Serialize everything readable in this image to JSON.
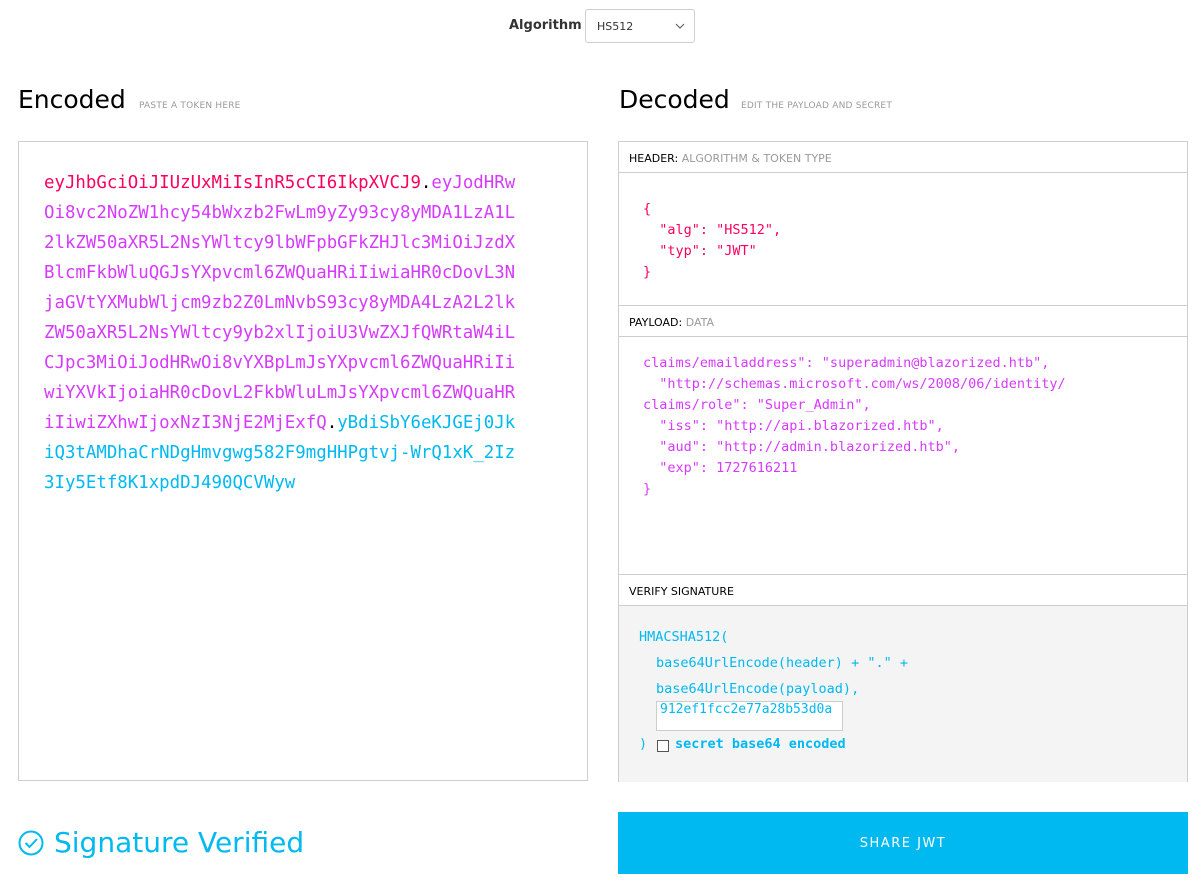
{
  "algorithm": {
    "label": "Algorithm",
    "selected": "HS512"
  },
  "encoded": {
    "title": "Encoded",
    "subtitle": "PASTE A TOKEN HERE",
    "token_header": "eyJhbGciOiJIUzUxMiIsInR5cCI6IkpXVCJ9",
    "token_payload": "eyJodHRwOi8vc2NoZW1hcy54bWxzb2FwLm9yZy93cy8yMDA1LzA1L2lkZW50aXR5L2NsYWltcy9lbWFpbGFkZHJlc3MiOiJzdXBlcmFkbWluQGJsYXpvcml6ZWQuaHRiIiwiaHR0cDovL3NjaGVtYXMubWljcm9zb2Z0LmNvbS93cy8yMDA4LzA2L2lkZW50aXR5L2NsYWltcy9yb2xlIjoiU3VwZXJfQWRtaW4iLCJpc3MiOiJodHRwOi8vYXBpLmJsYXpvcml6ZWQuaHRiIiwiYXVkIjoiaHR0cDovL2FkbWluLmJsYXpvcml6ZWQuaHRiIiwiZXhwIjoxNzI3NjE2MjExfQ",
    "token_signature": "yBdiSbY6eKJGEj0JkiQ3tAMDhaCrNDgHmvgwg582F9mgHHPgtvj-WrQ1xK_2Iz3Iy5Etf8K1xpdDJ490QCVWyw",
    "dot": "."
  },
  "decoded": {
    "title": "Decoded",
    "subtitle": "EDIT THE PAYLOAD AND SECRET",
    "header_section": {
      "label": "HEADER:",
      "sublabel": "ALGORITHM & TOKEN TYPE"
    },
    "header_json": "{\n  \"alg\": \"HS512\",\n  \"typ\": \"JWT\"\n}",
    "payload_section": {
      "label": "PAYLOAD:",
      "sublabel": "DATA"
    },
    "payload_json": "claims/emailaddress\": \"superadmin@blazorized.htb\",\n  \"http://schemas.microsoft.com/ws/2008/06/identity/\nclaims/role\": \"Super_Admin\",\n  \"iss\": \"http://api.blazorized.htb\",\n  \"aud\": \"http://admin.blazorized.htb\",\n  \"exp\": 1727616211\n}",
    "verify_section": {
      "label": "VERIFY SIGNATURE"
    },
    "verify": {
      "line1": "HMACSHA512(",
      "line2": "base64UrlEncode(header) + \".\" +",
      "line3": "base64UrlEncode(payload),",
      "secret_value": "912ef1fcc2e77a28b53d0a",
      "line5": ")",
      "checkbox_label": "secret base64 encoded"
    }
  },
  "status": {
    "text": "Signature Verified",
    "color": "#00b9f1"
  },
  "share_button": {
    "label": "SHARE JWT"
  },
  "colors": {
    "header": "#fb015b",
    "payload": "#d63aff",
    "signature": "#00b9f1"
  }
}
